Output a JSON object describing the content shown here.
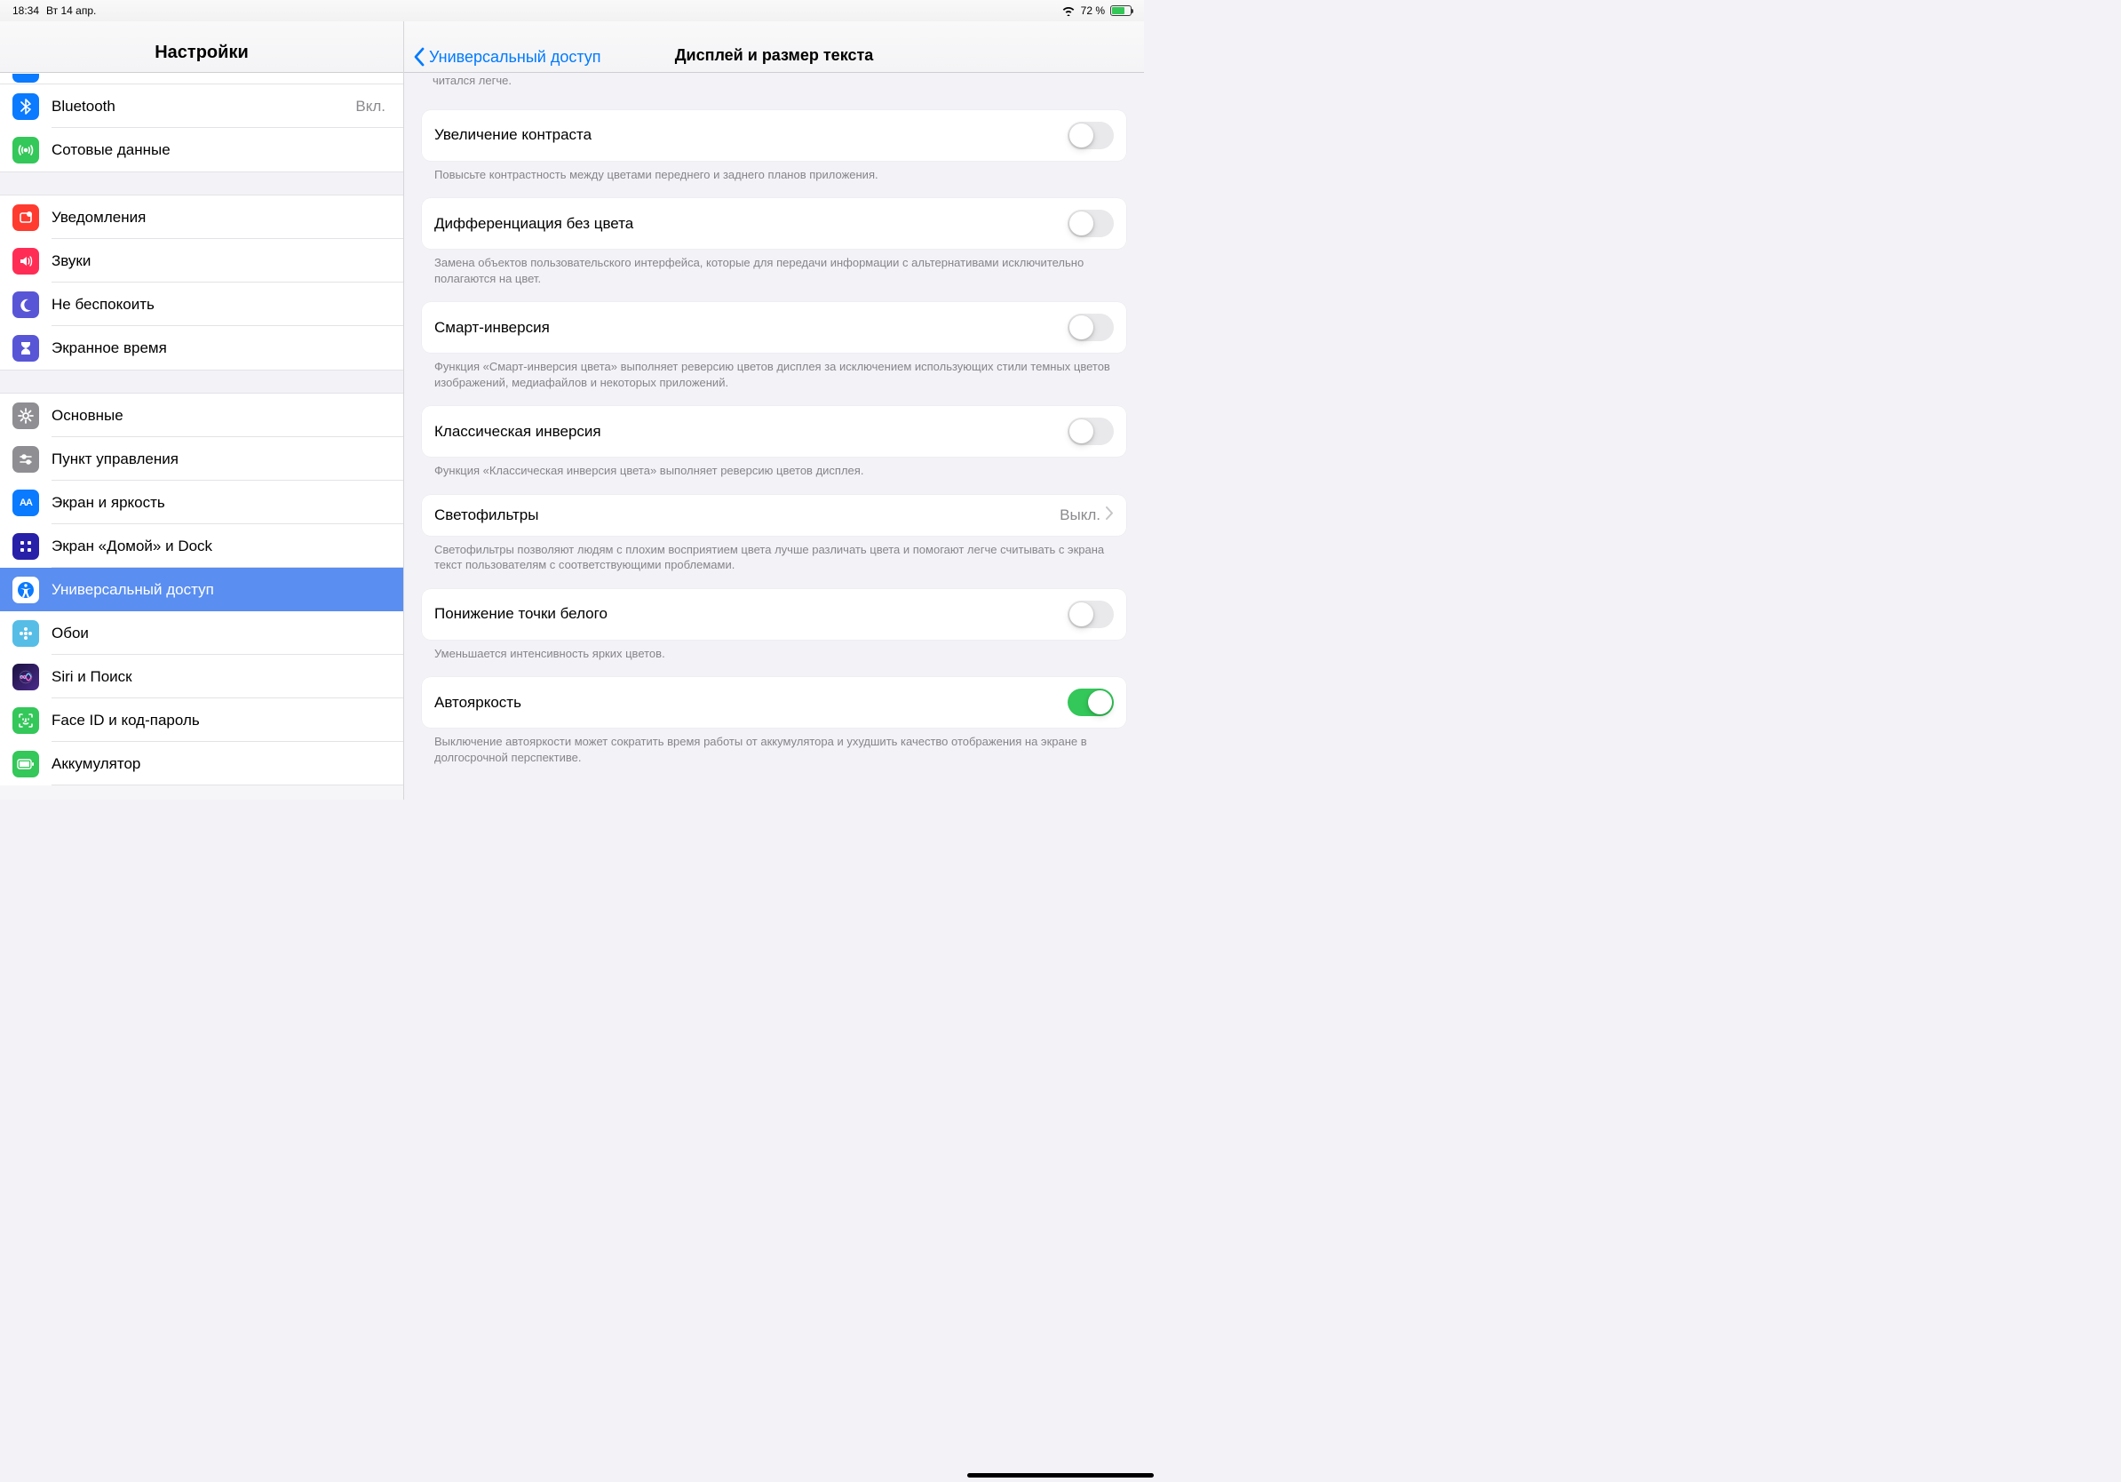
{
  "statusbar": {
    "time": "18:34",
    "date": "Вт 14 апр.",
    "battery": "72 %"
  },
  "sidebar": {
    "title": "Настройки",
    "g0": [
      {
        "label": ""
      }
    ],
    "g1": [
      {
        "label": "Bluetooth",
        "value": "Вкл."
      },
      {
        "label": "Сотовые данные"
      }
    ],
    "g2": [
      {
        "label": "Уведомления"
      },
      {
        "label": "Звуки"
      },
      {
        "label": "Не беспокоить"
      },
      {
        "label": "Экранное время"
      }
    ],
    "g3": [
      {
        "label": "Основные"
      },
      {
        "label": "Пункт управления"
      },
      {
        "label": "Экран и яркость"
      },
      {
        "label": "Экран «Домой» и Dock"
      },
      {
        "label": "Универсальный доступ"
      },
      {
        "label": "Обои"
      },
      {
        "label": "Siri и Поиск"
      },
      {
        "label": "Face ID и код-пароль"
      },
      {
        "label": "Аккумулятор"
      }
    ]
  },
  "detail": {
    "back": "Универсальный доступ",
    "title": "Дисплей и размер текста",
    "cutoff": "читался легче.",
    "rows": [
      {
        "label": "Увеличение контраста",
        "desc": "Повысьте контрастность между цветами переднего и заднего планов приложения."
      },
      {
        "label": "Дифференциация без цвета",
        "desc": "Замена объектов пользовательского интерфейса, которые для передачи информации с альтернативами исключительно полагаются на цвет."
      },
      {
        "label": "Смарт-инверсия",
        "desc": "Функция «Смарт-инверсия цвета» выполняет реверсию цветов дисплея за исключением использующих стили темных цветов изображений, медиафайлов и некоторых приложений."
      },
      {
        "label": "Классическая инверсия",
        "desc": "Функция «Классическая инверсия цвета» выполняет реверсию цветов дисплея."
      },
      {
        "label": "Светофильтры",
        "value": "Выкл.",
        "desc": "Светофильтры позволяют людям с плохим восприятием цвета лучше различать цвета и помогают легче считывать с экрана текст пользователям с соответствующими проблемами."
      },
      {
        "label": "Понижение точки белого",
        "desc": "Уменьшается интенсивность ярких цветов."
      },
      {
        "label": "Автояркость",
        "on": true,
        "desc": "Выключение автояркости может сократить время работы от аккумулятора и ухудшить качество отображения на экране в долгосрочной перспективе."
      }
    ]
  }
}
